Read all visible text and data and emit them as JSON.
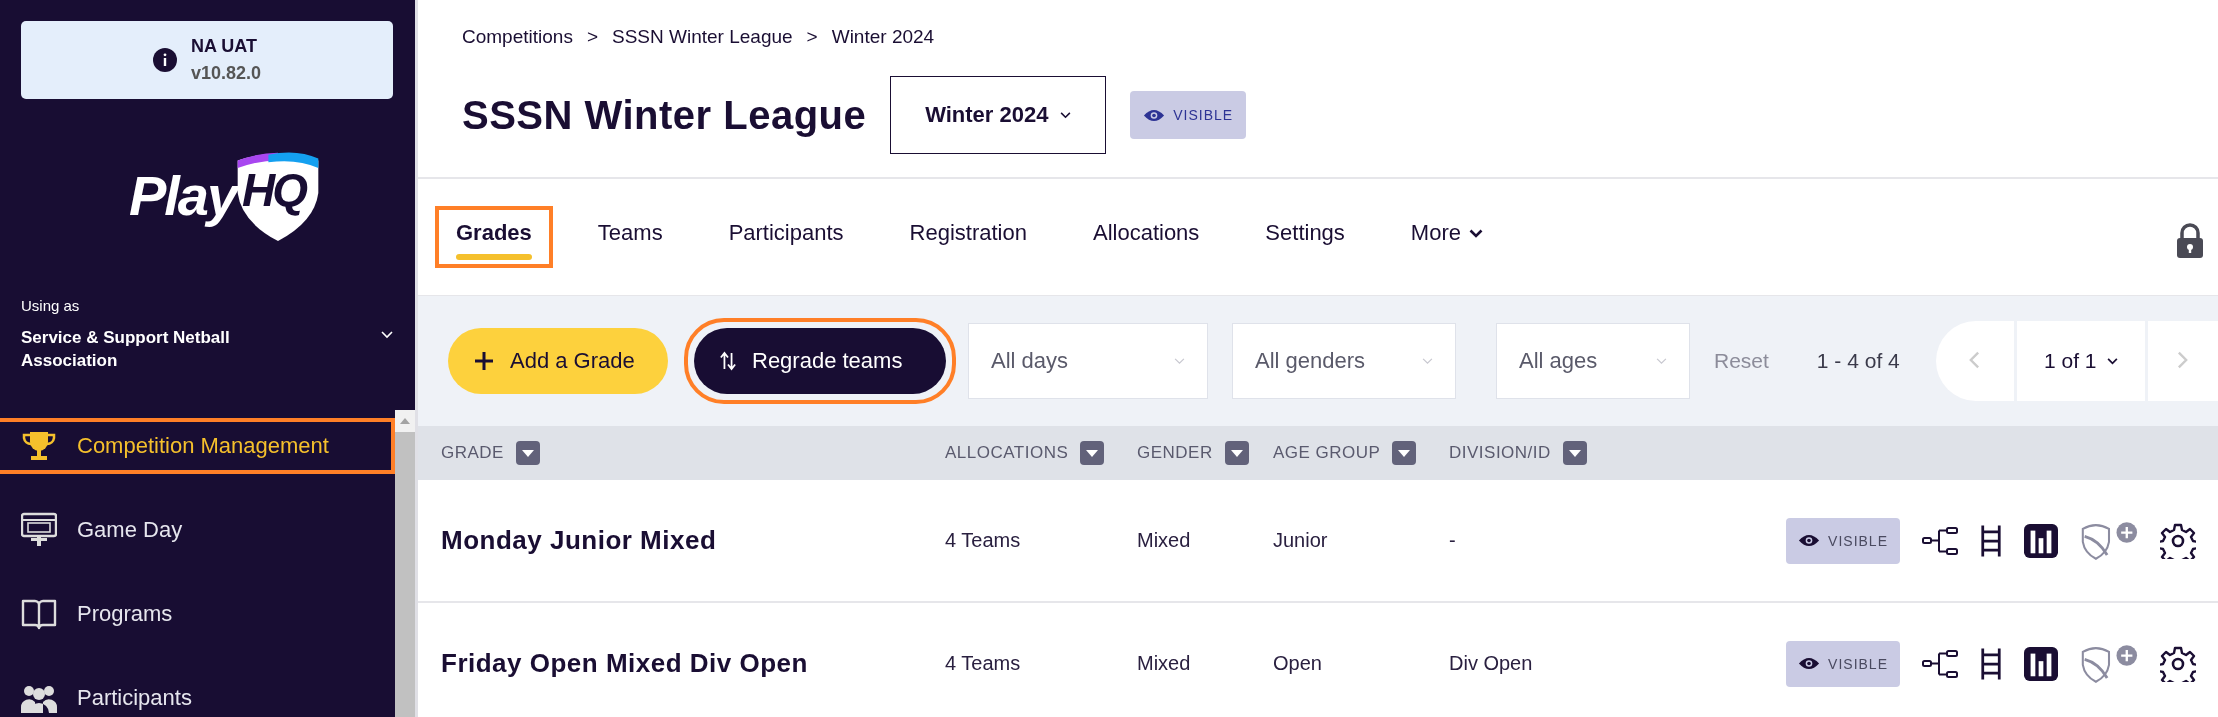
{
  "env_banner": {
    "name": "NA UAT",
    "version": "v10.82.0"
  },
  "logo": {
    "word": "Play",
    "mark": "HQ"
  },
  "account": {
    "label": "Using as",
    "organisation": "Service & Support Netball Association"
  },
  "nav": [
    {
      "label": "Competition Management",
      "kind": "trophy",
      "selected": true,
      "highlighted": true
    },
    {
      "label": "Game Day",
      "kind": "scoreboard",
      "selected": false,
      "highlighted": false
    },
    {
      "label": "Programs",
      "kind": "book",
      "selected": false,
      "highlighted": false
    },
    {
      "label": "Participants",
      "kind": "people",
      "selected": false,
      "highlighted": false
    }
  ],
  "breadcrumbs": [
    "Competitions",
    "SSSN Winter League",
    "Winter 2024"
  ],
  "breadcrumb_separator": ">",
  "title": "SSSN Winter League",
  "season_select": {
    "value": "Winter 2024"
  },
  "visibility": "VISIBLE",
  "tabs": [
    {
      "label": "Grades",
      "selected": true,
      "highlighted": true,
      "menu": false
    },
    {
      "label": "Teams",
      "selected": false,
      "highlighted": false,
      "menu": false
    },
    {
      "label": "Participants",
      "selected": false,
      "highlighted": false,
      "menu": false
    },
    {
      "label": "Registration",
      "selected": false,
      "highlighted": false,
      "menu": false
    },
    {
      "label": "Allocations",
      "selected": false,
      "highlighted": false,
      "menu": false
    },
    {
      "label": "Settings",
      "selected": false,
      "highlighted": false,
      "menu": false
    },
    {
      "label": "More",
      "selected": false,
      "highlighted": false,
      "menu": true
    }
  ],
  "toolbar": {
    "add_button": {
      "label": "Add a Grade",
      "highlighted": false
    },
    "regrade_button": {
      "label": "Regrade teams",
      "highlighted": true
    },
    "filters": [
      {
        "placeholder": "All days"
      },
      {
        "placeholder": "All genders"
      },
      {
        "placeholder": "All ages"
      }
    ],
    "reset": "Reset",
    "range": "1 - 4 of 4",
    "page": "1 of 1"
  },
  "table": {
    "columns": [
      "GRADE",
      "ALLOCATIONS",
      "GENDER",
      "AGE GROUP",
      "DIVISION/ID"
    ],
    "rows": [
      {
        "grade": "Monday Junior Mixed",
        "allocations": "4 Teams",
        "gender": "Mixed",
        "age_group": "Junior",
        "division": "-",
        "visibility": "VISIBLE"
      },
      {
        "grade": "Friday Open Mixed Div Open",
        "allocations": "4 Teams",
        "gender": "Mixed",
        "age_group": "Open",
        "division": "Div Open",
        "visibility": "VISIBLE"
      }
    ]
  }
}
